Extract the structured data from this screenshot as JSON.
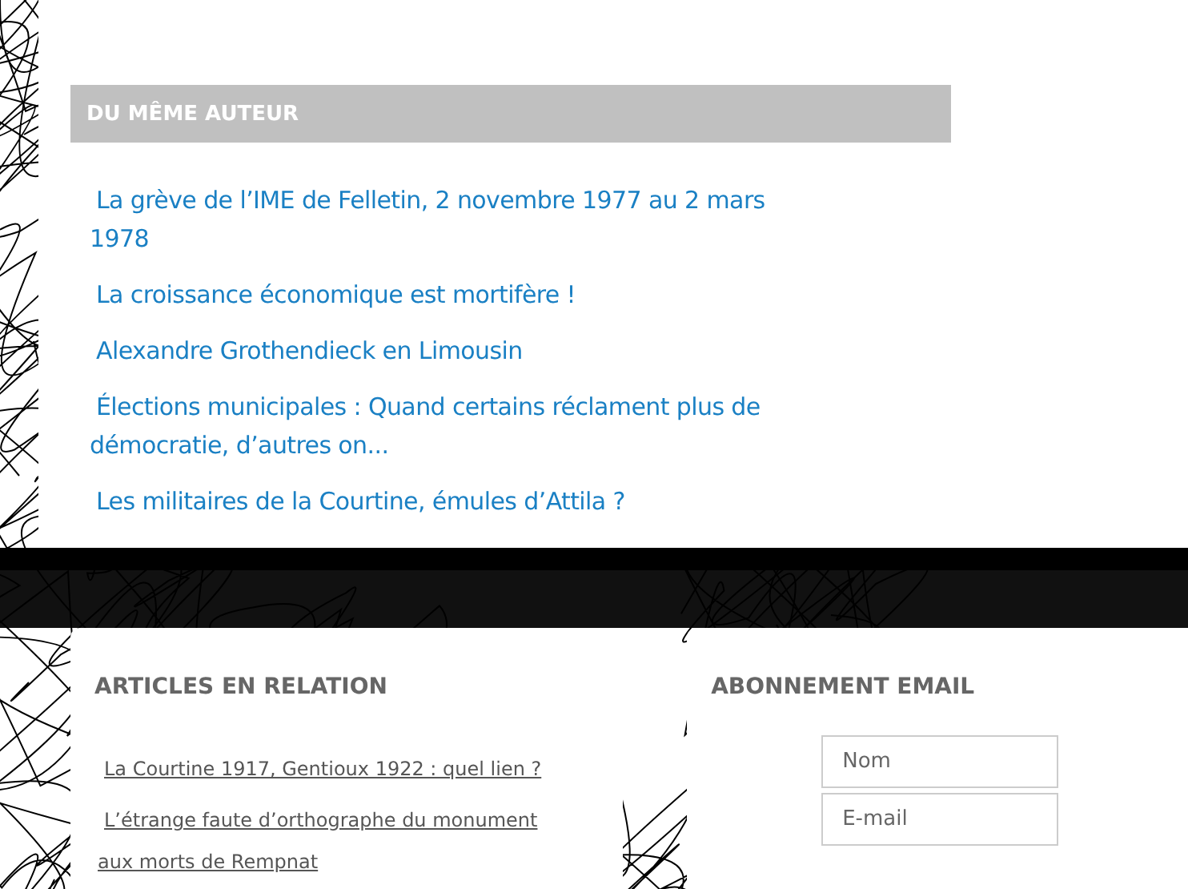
{
  "same_author": {
    "title": "DU MÊME AUTEUR",
    "links": [
      {
        "text": "La grève de l’IME de Felletin, 2 novembre 1977 au 2 mars 1978"
      },
      {
        "text": "La croissance économique est mortifère !"
      },
      {
        "text": "Alexandre Grothendieck en Limousin"
      },
      {
        "text": "Élections municipales : Quand certains réclament plus de démocratie, d’autres on..."
      },
      {
        "text": "Les militaires de la Courtine, émules d’Attila ?"
      }
    ]
  },
  "related": {
    "title": "ARTICLES EN RELATION",
    "links": [
      {
        "text": "La Courtine 1917, Gentioux 1922 : quel lien ?"
      },
      {
        "text": "L’étrange faute d’orthographe du monument aux morts de Rempnat"
      }
    ]
  },
  "subscribe": {
    "title": "ABONNEMENT EMAIL",
    "fields": [
      {
        "placeholder": "Nom"
      },
      {
        "placeholder": "E-mail"
      }
    ]
  }
}
